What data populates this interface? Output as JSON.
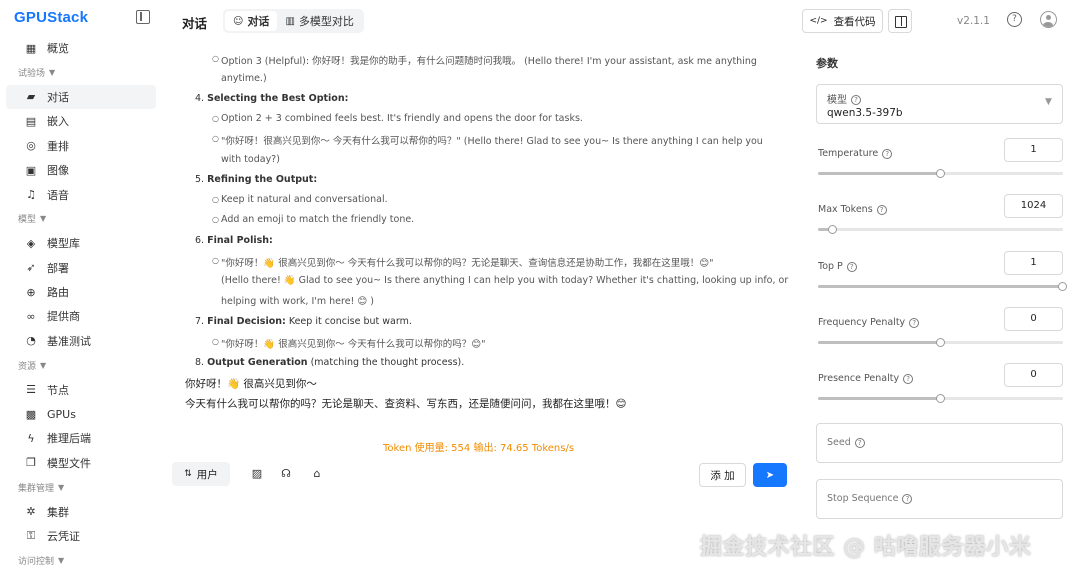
{
  "app": {
    "logo_text_g": "G",
    "logo_text_rest": "PUStack",
    "version": "v2.1.1"
  },
  "sidebar": {
    "items": [
      {
        "type": "item",
        "label": "概览",
        "icon": "grid-icon",
        "glyph": "▦"
      },
      {
        "type": "group",
        "label": "试验场"
      },
      {
        "type": "item",
        "label": "对话",
        "icon": "chat-icon",
        "glyph": "▰",
        "active": true
      },
      {
        "type": "item",
        "label": "嵌入",
        "icon": "embed-icon",
        "glyph": "▤"
      },
      {
        "type": "item",
        "label": "重排",
        "icon": "rerank-icon",
        "glyph": "◎"
      },
      {
        "type": "item",
        "label": "图像",
        "icon": "image-icon",
        "glyph": "▣"
      },
      {
        "type": "item",
        "label": "语音",
        "icon": "audio-icon",
        "glyph": "♫"
      },
      {
        "type": "group",
        "label": "模型"
      },
      {
        "type": "item",
        "label": "模型库",
        "icon": "layers-icon",
        "glyph": "◈"
      },
      {
        "type": "item",
        "label": "部署",
        "icon": "rocket-icon",
        "glyph": "➶"
      },
      {
        "type": "item",
        "label": "路由",
        "icon": "globe-icon",
        "glyph": "⊕"
      },
      {
        "type": "item",
        "label": "提供商",
        "icon": "link-icon",
        "glyph": "∞"
      },
      {
        "type": "item",
        "label": "基准测试",
        "icon": "gauge-icon",
        "glyph": "◔"
      },
      {
        "type": "group",
        "label": "资源"
      },
      {
        "type": "item",
        "label": "节点",
        "icon": "server-icon",
        "glyph": "☰"
      },
      {
        "type": "item",
        "label": "GPUs",
        "icon": "chip-icon",
        "glyph": "▩"
      },
      {
        "type": "item",
        "label": "推理后端",
        "icon": "bolt-icon",
        "glyph": "ϟ"
      },
      {
        "type": "item",
        "label": "模型文件",
        "icon": "files-icon",
        "glyph": "❐"
      },
      {
        "type": "group",
        "label": "集群管理"
      },
      {
        "type": "item",
        "label": "集群",
        "icon": "cluster-icon",
        "glyph": "✲"
      },
      {
        "type": "item",
        "label": "云凭证",
        "icon": "key-icon",
        "glyph": "⚿"
      },
      {
        "type": "group",
        "label": "访问控制"
      }
    ]
  },
  "header": {
    "title": "对话",
    "tabs": [
      {
        "label": "对话",
        "active": true,
        "glyph": "☺"
      },
      {
        "label": "多模型对比",
        "active": false,
        "glyph": "▥"
      }
    ],
    "view_code_label": "查看代码"
  },
  "chat": {
    "lines": [
      {
        "kind": "sub",
        "text": "Option 3 (Helpful): 你好呀！我是你的助手，有什么问题随时问我哦。 (Hello there! I'm your assistant, ask me anything"
      },
      {
        "kind": "cont",
        "text": "anytime.)"
      },
      {
        "kind": "head",
        "num": "4.",
        "bold": "Selecting the Best Option:",
        "rest": ""
      },
      {
        "kind": "sub",
        "text": "Option 2 + 3 combined feels best. It's friendly and opens the door for tasks."
      },
      {
        "kind": "sub",
        "text": "\"你好呀！很高兴见到你～ 今天有什么我可以帮你的吗？\" (Hello there! Glad to see you~ Is there anything I can help you"
      },
      {
        "kind": "cont",
        "text": "with today?)"
      },
      {
        "kind": "head",
        "num": "5.",
        "bold": "Refining the Output:",
        "rest": ""
      },
      {
        "kind": "sub",
        "text": "Keep it natural and conversational."
      },
      {
        "kind": "sub",
        "text": "Add an emoji to match the friendly tone."
      },
      {
        "kind": "head",
        "num": "6.",
        "bold": "Final Polish:",
        "rest": ""
      },
      {
        "kind": "sub",
        "text": "\"你好呀！👋 很高兴见到你～ 今天有什么我可以帮你的吗？无论是聊天、查询信息还是协助工作，我都在这里哦！😊\""
      },
      {
        "kind": "cont",
        "text": "(Hello there! 👋 Glad to see you~ Is there anything I can help you with today? Whether it's chatting, looking up info, or"
      },
      {
        "kind": "cont",
        "text": "helping with work, I'm here! 😊 )"
      },
      {
        "kind": "head",
        "num": "7.",
        "bold": "Final Decision:",
        "rest": " Keep it concise but warm."
      },
      {
        "kind": "sub",
        "text": "\"你好呀！👋 很高兴见到你～ 今天有什么我可以帮你的吗？😊\""
      },
      {
        "kind": "head",
        "num": "8.",
        "bold": "Output Generation",
        "rest": " (matching the thought process)."
      }
    ],
    "answer_lines": [
      "你好呀！👋 很高兴见到你～",
      "今天有什么我可以帮你的吗？无论是聊天、查资料、写东西，还是随便问问，我都在这里哦！😊"
    ],
    "token_stats": "Token 使用量: 554     输出: 74.65 Tokens/s"
  },
  "input_bar": {
    "role_label": "用户",
    "add_label": "添 加",
    "send_glyph": "➤"
  },
  "params": {
    "title": "参数",
    "model_label": "模型",
    "model_value": "qwen3.5-397b",
    "sliders": [
      {
        "name": "temperature",
        "label": "Temperature",
        "value": "1",
        "fraction": 0.5
      },
      {
        "name": "max-tokens",
        "label": "Max Tokens",
        "value": "1024",
        "fraction": 0.06
      },
      {
        "name": "top-p",
        "label": "Top P",
        "value": "1",
        "fraction": 1.0
      },
      {
        "name": "frequency-penalty",
        "label": "Frequency Penalty",
        "value": "0",
        "fraction": 0.5
      },
      {
        "name": "presence-penalty",
        "label": "Presence Penalty",
        "value": "0",
        "fraction": 0.5
      }
    ],
    "seed_label": "Seed",
    "stop_sequence_label": "Stop Sequence"
  },
  "watermark": "掘金技术社区 @ 咕噜服务器小米"
}
